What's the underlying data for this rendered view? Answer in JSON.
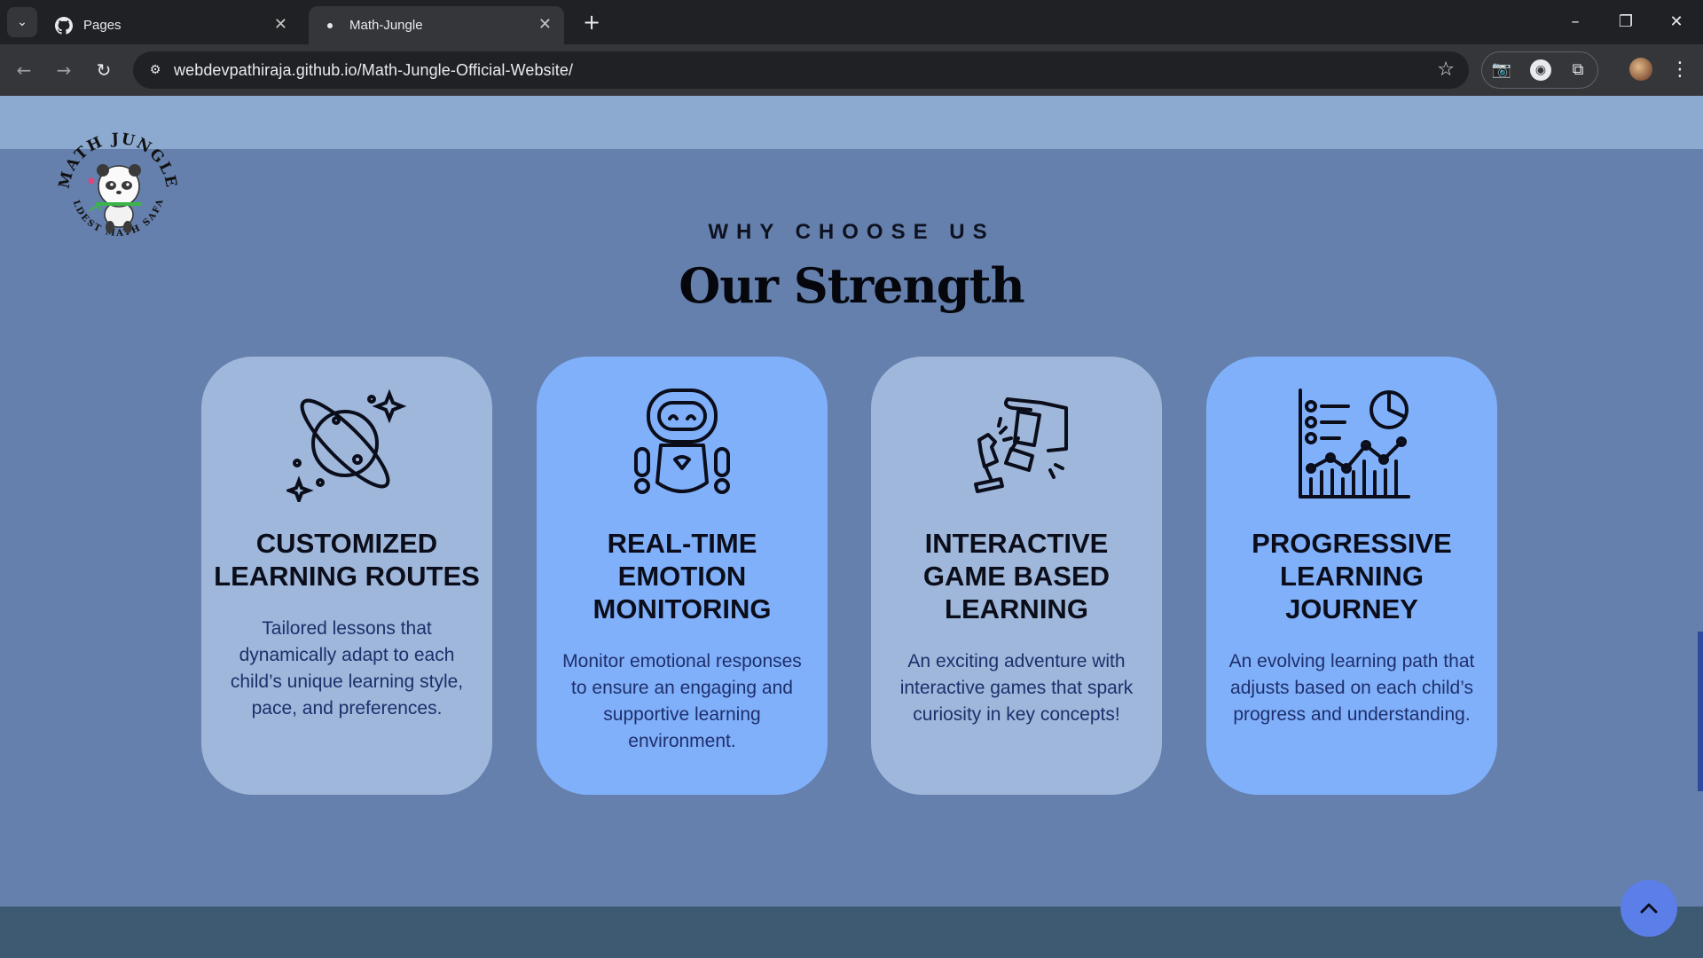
{
  "browser": {
    "tabs": [
      {
        "label": "Pages",
        "icon": "github-icon",
        "active": false
      },
      {
        "label": "Math-Jungle",
        "icon": "site-favicon",
        "active": true
      }
    ],
    "url": "webdevpathiraja.github.io/Math-Jungle-Official-Website/"
  },
  "logo": {
    "text_top": "MATH JUNGLE",
    "text_bottom": "WILDEST MATH SAFARI",
    "icon": "panda-mascot-icon"
  },
  "section": {
    "eyebrow": "WHY CHOOSE US",
    "title": "Our Strength"
  },
  "cards": [
    {
      "icon": "planet-icon",
      "title": "CUSTOMIZED LEARNING ROUTES",
      "description": "Tailored lessons that dynamically adapt to each child’s unique learning style, pace, and preferences.",
      "bg_color": "#9fb7db"
    },
    {
      "icon": "robot-icon",
      "title": "REAL-TIME EMOTION MONITORING",
      "description": "Monitor emotional responses to ensure an engaging and supportive learning environment.",
      "bg_color": "#81b0fb"
    },
    {
      "icon": "chess-hand-icon",
      "title": "INTERACTIVE GAME BASED LEARNING",
      "description": "An exciting adventure with interactive games that spark curiosity in key concepts!",
      "bg_color": "#9fb7db"
    },
    {
      "icon": "analytics-chart-icon",
      "title": "PROGRESSIVE LEARNING JOURNEY",
      "description": "An evolving learning path that adjusts based on each child’s progress and understanding.",
      "bg_color": "#81b0fb"
    }
  ],
  "colors": {
    "page_bg": "#6580ac",
    "nav_strip": "#8caad0",
    "footer_strip": "#3d5a72",
    "scroll_top_button": "#5b7ee8"
  }
}
